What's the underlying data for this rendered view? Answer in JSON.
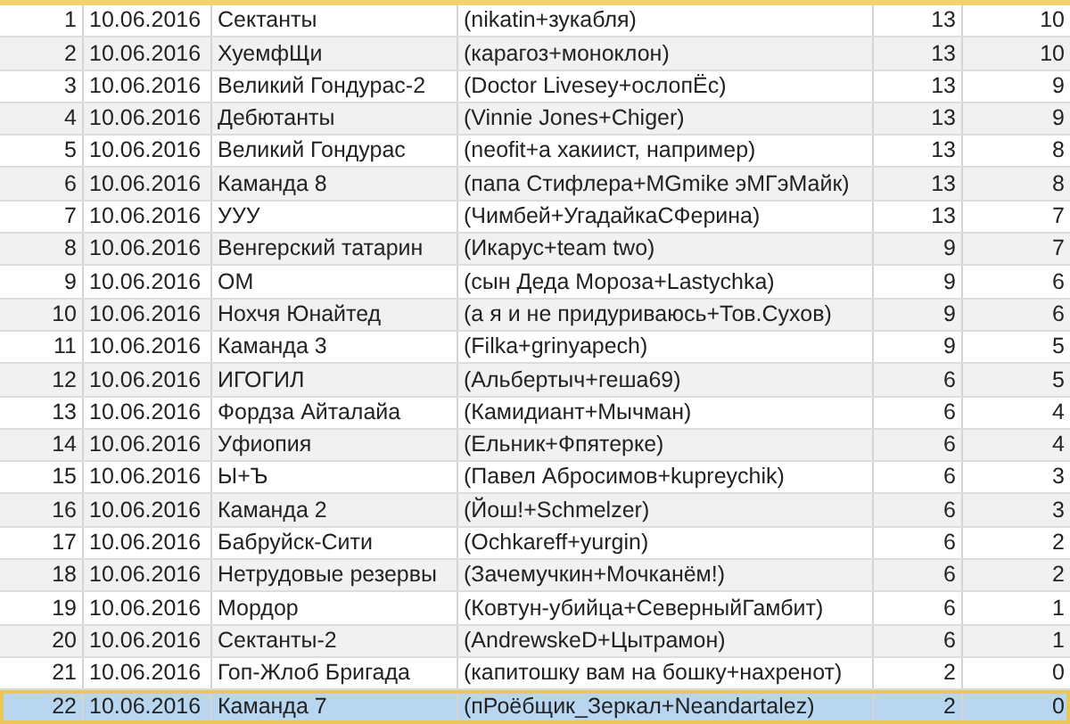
{
  "rows": [
    {
      "number": "1",
      "date": "10.06.2016",
      "team": "Сектанты",
      "players": "(nikatin+зукабля)",
      "column_5": "13",
      "column_6": "10",
      "selected": false
    },
    {
      "number": "2",
      "date": "10.06.2016",
      "team": "ХуемфЩи",
      "players": "(карагоз+моноклон)",
      "column_5": "13",
      "column_6": "10",
      "selected": false
    },
    {
      "number": "3",
      "date": "10.06.2016",
      "team": "Великий Гондурас-2",
      "players": "(Doctor Livesey+ослопЁс)",
      "column_5": "13",
      "column_6": "9",
      "selected": false
    },
    {
      "number": "4",
      "date": "10.06.2016",
      "team": "Дебютанты",
      "players": "(Vinnie Jones+Chiger)",
      "column_5": "13",
      "column_6": "9",
      "selected": false
    },
    {
      "number": "5",
      "date": "10.06.2016",
      "team": "Великий Гондурас",
      "players": "(neofit+а хакиист, например)",
      "column_5": "13",
      "column_6": "8",
      "selected": false
    },
    {
      "number": "6",
      "date": "10.06.2016",
      "team": "Каманда 8",
      "players": "(папа Стифлера+MGmike эМГэМайк)",
      "column_5": "13",
      "column_6": "8",
      "selected": false
    },
    {
      "number": "7",
      "date": "10.06.2016",
      "team": "УУУ",
      "players": "(Чимбей+УгадайкаСФерина)",
      "column_5": "13",
      "column_6": "7",
      "selected": false
    },
    {
      "number": "8",
      "date": "10.06.2016",
      "team": "Венгерский татарин",
      "players": "(Икарус+team two)",
      "column_5": "9",
      "column_6": "7",
      "selected": false
    },
    {
      "number": "9",
      "date": "10.06.2016",
      "team": "ОМ",
      "players": "(сын Деда Мороза+Lastychka)",
      "column_5": "9",
      "column_6": "6",
      "selected": false
    },
    {
      "number": "10",
      "date": "10.06.2016",
      "team": "Нохчя Юнайтед",
      "players": "(а я и не придуриваюсь+Тов.Сухов)",
      "column_5": "9",
      "column_6": "6",
      "selected": false
    },
    {
      "number": "11",
      "date": "10.06.2016",
      "team": "Каманда 3",
      "players": "(Filka+grinyapech)",
      "column_5": "9",
      "column_6": "5",
      "selected": false
    },
    {
      "number": "12",
      "date": "10.06.2016",
      "team": "ИГОГИЛ",
      "players": "(Альбертыч+геша69)",
      "column_5": "6",
      "column_6": "5",
      "selected": false
    },
    {
      "number": "13",
      "date": "10.06.2016",
      "team": "Фордза Айталайа",
      "players": "(Камидиант+Мычман)",
      "column_5": "6",
      "column_6": "4",
      "selected": false
    },
    {
      "number": "14",
      "date": "10.06.2016",
      "team": "Уфиопия",
      "players": "(Ельник+Фпятерке)",
      "column_5": "6",
      "column_6": "4",
      "selected": false
    },
    {
      "number": "15",
      "date": "10.06.2016",
      "team": "Ы+Ъ",
      "players": "(Павел Абросимов+kupreychik)",
      "column_5": "6",
      "column_6": "3",
      "selected": false
    },
    {
      "number": "16",
      "date": "10.06.2016",
      "team": "Каманда 2",
      "players": "(Йош!+Schmelzer)",
      "column_5": "6",
      "column_6": "3",
      "selected": false
    },
    {
      "number": "17",
      "date": "10.06.2016",
      "team": "Бабруйск-Сити",
      "players": "(Ochkareff+yurgin)",
      "column_5": "6",
      "column_6": "2",
      "selected": false
    },
    {
      "number": "18",
      "date": "10.06.2016",
      "team": "Нетрудовые резервы",
      "players": "(Зачемучкин+Мочканём!)",
      "column_5": "6",
      "column_6": "2",
      "selected": false
    },
    {
      "number": "19",
      "date": "10.06.2016",
      "team": "Мордор",
      "players": "(Ковтун-убийца+СеверныйГамбит)",
      "column_5": "6",
      "column_6": "1",
      "selected": false
    },
    {
      "number": "20",
      "date": "10.06.2016",
      "team": "Сектанты-2",
      "players": "(AndrewskeD+Цытрамон)",
      "column_5": "6",
      "column_6": "1",
      "selected": false
    },
    {
      "number": "21",
      "date": "10.06.2016",
      "team": "Гоп-Жлоб Бригада",
      "players": "(капитошку вам на бошку+нахренот)",
      "column_5": "2",
      "column_6": "0",
      "selected": false
    },
    {
      "number": "22",
      "date": "10.06.2016",
      "team": "Каманда 7",
      "players": "(пРоёбщик_Зеркал+Neandartalez)",
      "column_5": "2",
      "column_6": "0",
      "selected": true
    }
  ]
}
